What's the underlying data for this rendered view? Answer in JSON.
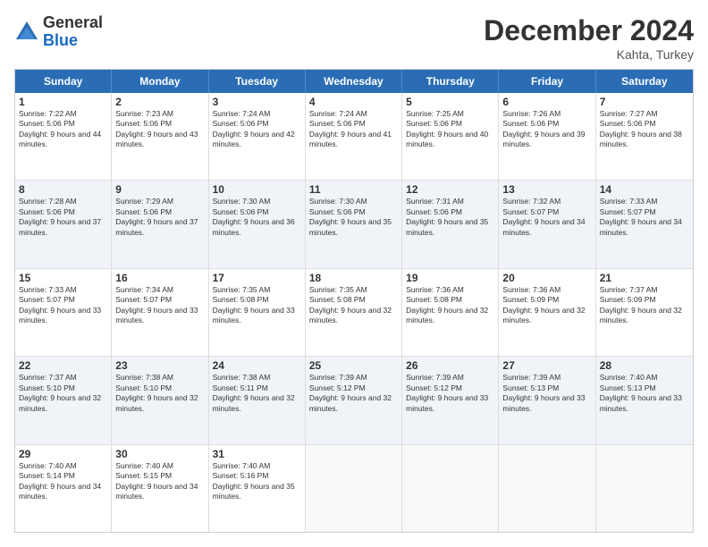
{
  "logo": {
    "general": "General",
    "blue": "Blue"
  },
  "header": {
    "month": "December 2024",
    "location": "Kahta, Turkey"
  },
  "days": [
    "Sunday",
    "Monday",
    "Tuesday",
    "Wednesday",
    "Thursday",
    "Friday",
    "Saturday"
  ],
  "weeks": [
    [
      {
        "num": "1",
        "rise": "7:22 AM",
        "set": "5:06 PM",
        "daylight": "9 hours and 44 minutes."
      },
      {
        "num": "2",
        "rise": "7:23 AM",
        "set": "5:06 PM",
        "daylight": "9 hours and 43 minutes."
      },
      {
        "num": "3",
        "rise": "7:24 AM",
        "set": "5:06 PM",
        "daylight": "9 hours and 42 minutes."
      },
      {
        "num": "4",
        "rise": "7:24 AM",
        "set": "5:06 PM",
        "daylight": "9 hours and 41 minutes."
      },
      {
        "num": "5",
        "rise": "7:25 AM",
        "set": "5:06 PM",
        "daylight": "9 hours and 40 minutes."
      },
      {
        "num": "6",
        "rise": "7:26 AM",
        "set": "5:06 PM",
        "daylight": "9 hours and 39 minutes."
      },
      {
        "num": "7",
        "rise": "7:27 AM",
        "set": "5:06 PM",
        "daylight": "9 hours and 38 minutes."
      }
    ],
    [
      {
        "num": "8",
        "rise": "7:28 AM",
        "set": "5:06 PM",
        "daylight": "9 hours and 37 minutes."
      },
      {
        "num": "9",
        "rise": "7:29 AM",
        "set": "5:06 PM",
        "daylight": "9 hours and 37 minutes."
      },
      {
        "num": "10",
        "rise": "7:30 AM",
        "set": "5:06 PM",
        "daylight": "9 hours and 36 minutes."
      },
      {
        "num": "11",
        "rise": "7:30 AM",
        "set": "5:06 PM",
        "daylight": "9 hours and 35 minutes."
      },
      {
        "num": "12",
        "rise": "7:31 AM",
        "set": "5:06 PM",
        "daylight": "9 hours and 35 minutes."
      },
      {
        "num": "13",
        "rise": "7:32 AM",
        "set": "5:07 PM",
        "daylight": "9 hours and 34 minutes."
      },
      {
        "num": "14",
        "rise": "7:33 AM",
        "set": "5:07 PM",
        "daylight": "9 hours and 34 minutes."
      }
    ],
    [
      {
        "num": "15",
        "rise": "7:33 AM",
        "set": "5:07 PM",
        "daylight": "9 hours and 33 minutes."
      },
      {
        "num": "16",
        "rise": "7:34 AM",
        "set": "5:07 PM",
        "daylight": "9 hours and 33 minutes."
      },
      {
        "num": "17",
        "rise": "7:35 AM",
        "set": "5:08 PM",
        "daylight": "9 hours and 33 minutes."
      },
      {
        "num": "18",
        "rise": "7:35 AM",
        "set": "5:08 PM",
        "daylight": "9 hours and 32 minutes."
      },
      {
        "num": "19",
        "rise": "7:36 AM",
        "set": "5:08 PM",
        "daylight": "9 hours and 32 minutes."
      },
      {
        "num": "20",
        "rise": "7:36 AM",
        "set": "5:09 PM",
        "daylight": "9 hours and 32 minutes."
      },
      {
        "num": "21",
        "rise": "7:37 AM",
        "set": "5:09 PM",
        "daylight": "9 hours and 32 minutes."
      }
    ],
    [
      {
        "num": "22",
        "rise": "7:37 AM",
        "set": "5:10 PM",
        "daylight": "9 hours and 32 minutes."
      },
      {
        "num": "23",
        "rise": "7:38 AM",
        "set": "5:10 PM",
        "daylight": "9 hours and 32 minutes."
      },
      {
        "num": "24",
        "rise": "7:38 AM",
        "set": "5:11 PM",
        "daylight": "9 hours and 32 minutes."
      },
      {
        "num": "25",
        "rise": "7:39 AM",
        "set": "5:12 PM",
        "daylight": "9 hours and 32 minutes."
      },
      {
        "num": "26",
        "rise": "7:39 AM",
        "set": "5:12 PM",
        "daylight": "9 hours and 33 minutes."
      },
      {
        "num": "27",
        "rise": "7:39 AM",
        "set": "5:13 PM",
        "daylight": "9 hours and 33 minutes."
      },
      {
        "num": "28",
        "rise": "7:40 AM",
        "set": "5:13 PM",
        "daylight": "9 hours and 33 minutes."
      }
    ],
    [
      {
        "num": "29",
        "rise": "7:40 AM",
        "set": "5:14 PM",
        "daylight": "9 hours and 34 minutes."
      },
      {
        "num": "30",
        "rise": "7:40 AM",
        "set": "5:15 PM",
        "daylight": "9 hours and 34 minutes."
      },
      {
        "num": "31",
        "rise": "7:40 AM",
        "set": "5:16 PM",
        "daylight": "9 hours and 35 minutes."
      },
      null,
      null,
      null,
      null
    ]
  ]
}
